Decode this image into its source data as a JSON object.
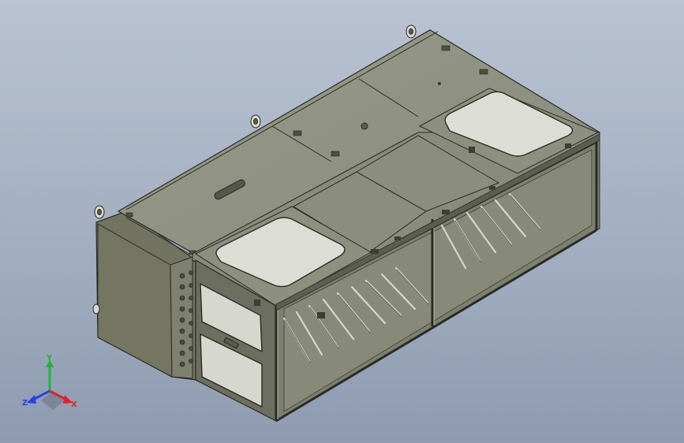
{
  "triad": {
    "x_label": "X",
    "y_label": "Y",
    "z_label": "Z",
    "x_color": "#e0202a",
    "y_color": "#1fb53a",
    "z_color": "#2a3fe0"
  },
  "model_colors": {
    "body_top": "#8f907d",
    "body_left": "#7b7d6c",
    "body_front": "#6f7262",
    "edge": "#2a2b24",
    "interior": "#858673",
    "rod": "#c8c9bf"
  }
}
